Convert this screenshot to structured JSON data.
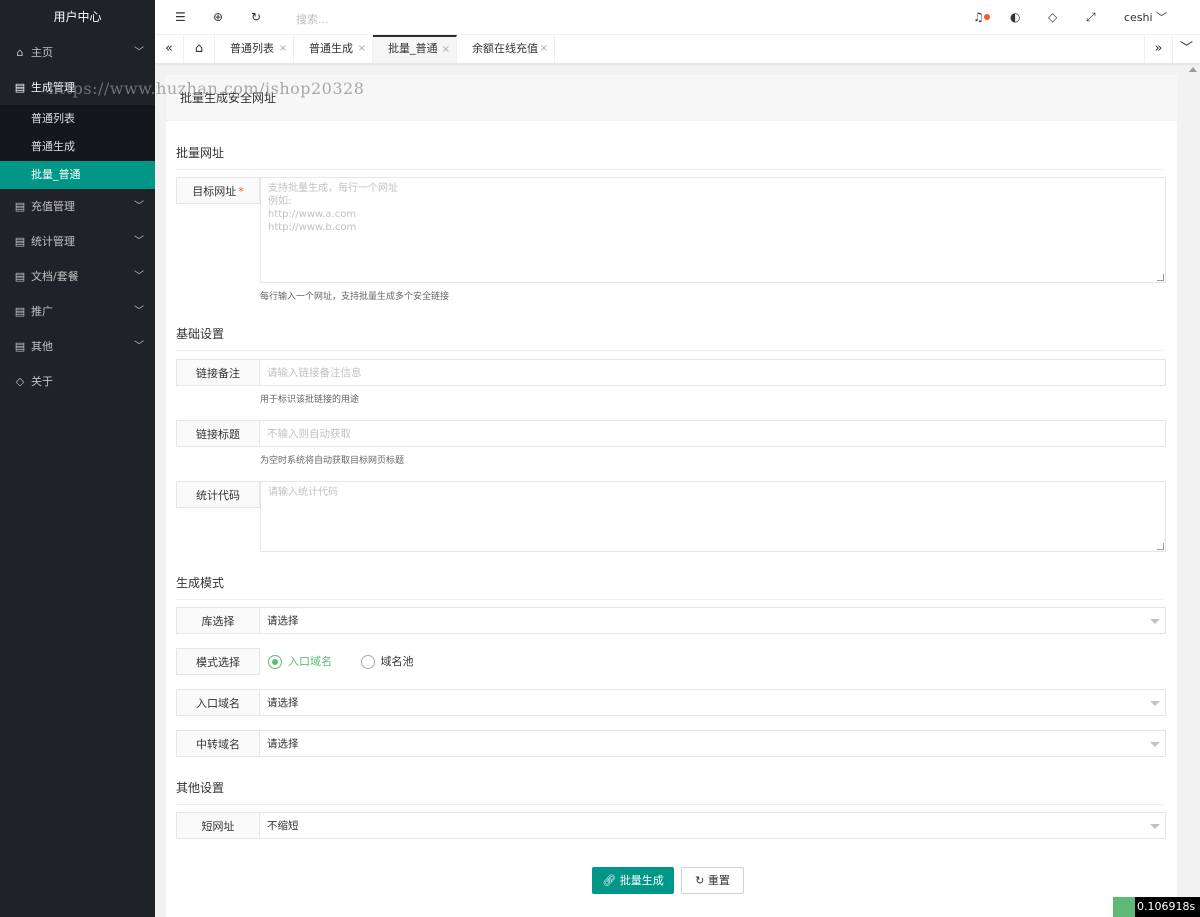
{
  "sidebar": {
    "logo": "用户中心",
    "items": [
      {
        "label": "主页",
        "icon": "home-icon",
        "chevron": true
      },
      {
        "label": "生成管理",
        "icon": "list-icon",
        "chevron": false
      },
      {
        "label": "充值管理",
        "icon": "list-icon",
        "chevron": true
      },
      {
        "label": "统计管理",
        "icon": "list-icon",
        "chevron": true
      },
      {
        "label": "文档/套餐",
        "icon": "list-icon",
        "chevron": true
      },
      {
        "label": "推广",
        "icon": "list-icon",
        "chevron": true
      },
      {
        "label": "其他",
        "icon": "list-icon",
        "chevron": true
      },
      {
        "label": "关于",
        "icon": "shield-icon",
        "chevron": false
      }
    ],
    "subitems": [
      "普通列表",
      "普通生成",
      "批量_普通"
    ]
  },
  "header": {
    "search_placeholder": "搜索...",
    "user": "ceshi"
  },
  "tabs": [
    "普通列表",
    "普通生成",
    "批量_普通",
    "余额在线充值"
  ],
  "card": {
    "title": "批量生成安全网址"
  },
  "sections": {
    "batch": "批量网址",
    "basic": "基础设置",
    "mode": "生成模式",
    "other": "其他设置"
  },
  "form": {
    "target_label": "目标网址",
    "target_required": "*",
    "target_placeholder": "支持批量生成，每行一个网址\n例如:\nhttp://www.a.com\nhttp://www.b.com",
    "target_hint": "每行输入一个网址，支持批量生成多个安全链接",
    "note_label": "链接备注",
    "note_placeholder": "请输入链接备注信息",
    "note_hint": "用于标识该批链接的用途",
    "title_label": "链接标题",
    "title_placeholder": "不输入则自动获取",
    "title_hint": "为空时系统将自动获取目标网页标题",
    "stats_label": "统计代码",
    "stats_placeholder": "请输入统计代码",
    "lib_label": "库选择",
    "lib_value": "请选择",
    "mode_label": "模式选择",
    "mode_option1": "入口域名",
    "mode_option2": "域名池",
    "entry_label": "入口域名",
    "entry_value": "请选择",
    "relay_label": "中转域名",
    "relay_value": "请选择",
    "short_label": "短网址",
    "short_value": "不缩短",
    "submit": "批量生成",
    "reset": "重置"
  },
  "watermark": "https://www.huzhan.com/ishop20328",
  "timer": "0.106918s"
}
